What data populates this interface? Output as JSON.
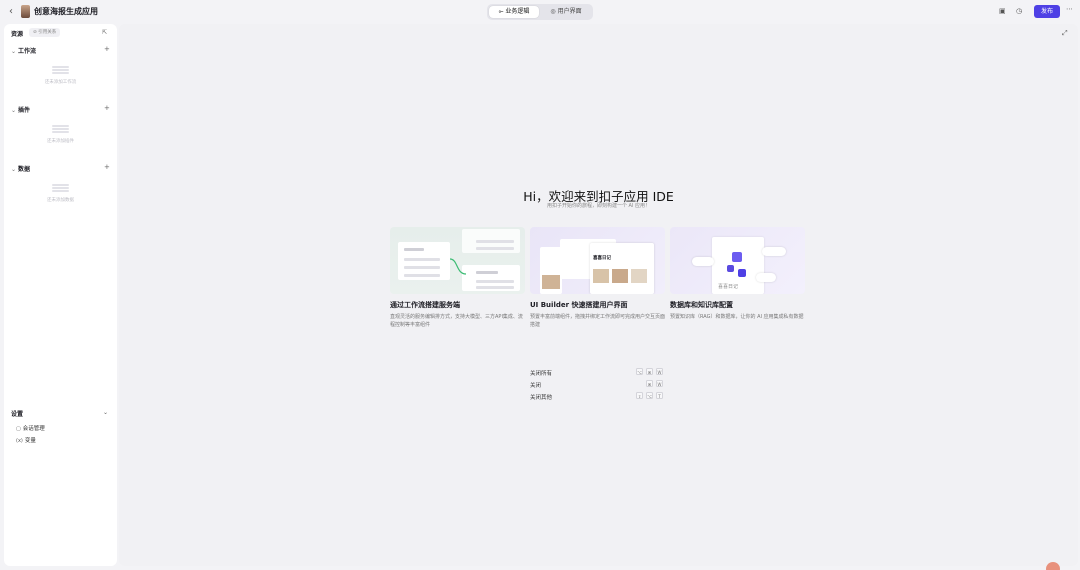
{
  "header": {
    "back_icon": "chevron-left-icon",
    "app_title": "创意海报生成应用",
    "tabs": [
      {
        "label": "业务逻辑",
        "icon": "workflow-icon",
        "active": true
      },
      {
        "label": "用户界面",
        "icon": "palette-icon",
        "active": false
      }
    ],
    "right_icons": [
      "package-icon",
      "history-icon",
      "more-icon"
    ],
    "publish_label": "发布",
    "accent_color": "#4e40e5"
  },
  "sidebar": {
    "title": "资源",
    "ref_button": "引用关系",
    "sections": [
      {
        "title": "工作流",
        "empty_text": "还未添加工作流"
      },
      {
        "title": "插件",
        "empty_text": "还未添加插件"
      },
      {
        "title": "数据",
        "empty_text": "还未添加数据"
      }
    ],
    "settings": {
      "title": "设置",
      "items": [
        {
          "label": "会话管理",
          "icon": "chat-icon"
        },
        {
          "label": "变量",
          "icon": "variable-icon"
        }
      ]
    }
  },
  "main": {
    "title": "Hi，欢迎来到扣子应用 IDE",
    "subtitle": "用扣子开始你的旅程，即刻构建一个 AI 应用！",
    "cards": [
      {
        "title": "通过工作流搭建服务端",
        "desc": "直观灵活的服务编辑排方式，支持大模型、三方API集成、流程控制等丰富组件"
      },
      {
        "title": "UI Builder 快速搭建用户界面",
        "desc": "预置丰富前端组件，拖拽并绑定工作流即可完成用户交互页面搭建",
        "preview_text": "喜喜日记"
      },
      {
        "title": "数据库和知识库配置",
        "desc": "预置知识库（RAG）和数据库，让你的 AI 应用集成私有数据",
        "preview_text": "喜喜日记"
      }
    ],
    "shortcuts": [
      {
        "label": "关闭所有",
        "keys": [
          "⌥",
          "⌘",
          "W"
        ]
      },
      {
        "label": "关闭",
        "keys": [
          "⌘",
          "W"
        ]
      },
      {
        "label": "关闭其他",
        "keys": [
          "⇧",
          "⌥",
          "T"
        ]
      }
    ]
  }
}
